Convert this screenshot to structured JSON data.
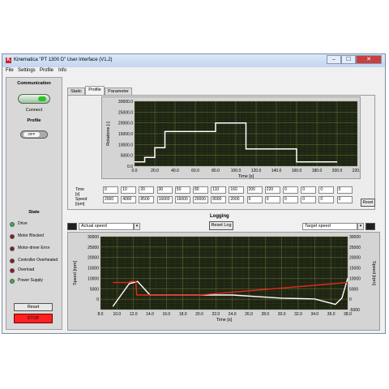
{
  "window": {
    "logo": "K",
    "title": "Kinematica \"PT 1300 D\" User Interface (V1.2)",
    "close_glyph": "✕",
    "min_glyph": "–",
    "max_glyph": "☐"
  },
  "menu": [
    "File",
    "Settings",
    "Profile",
    "Info"
  ],
  "left_panel": {
    "communication_label": "Communication",
    "connect_label": "Connect",
    "profile_label": "Profile",
    "profile_toggle": "OFF",
    "state_label": "State",
    "states": [
      {
        "label": "Drive",
        "color": "#3cb043"
      },
      {
        "label": "Motor Blocked",
        "color": "#8b1a1a"
      },
      {
        "label": "Motor-driver Error",
        "color": "#8b1a1a"
      },
      {
        "label": "Controller Overheated",
        "color": "#8b1a1a"
      },
      {
        "label": "Overload",
        "color": "#8b1a1a"
      },
      {
        "label": "Power Supply",
        "color": "#3cb043"
      }
    ],
    "reset_label": "Reset",
    "stop_label": "STOP"
  },
  "tabs": [
    {
      "label": "Static",
      "active": false
    },
    {
      "label": "Profile",
      "active": true
    },
    {
      "label": "Parameter",
      "active": false
    }
  ],
  "profile_grid": {
    "time_label": "Time [s]",
    "speed_label": "Speed [rpm]",
    "time_values": [
      "0",
      "10",
      "20",
      "30",
      "50",
      "80",
      "110",
      "160",
      "200",
      "220",
      "0",
      "0",
      "0",
      "0"
    ],
    "speed_values": [
      "2000",
      "4000",
      "8500",
      "16000",
      "16000",
      "20000",
      "8000",
      "2000",
      "0",
      "0",
      "0",
      "0",
      "0",
      "0"
    ],
    "reset_label": "Reset"
  },
  "logging": {
    "title": "Logging",
    "reset_log_label": "Reset Log",
    "left_series": "Actual speed",
    "right_series": "Target speed"
  },
  "chart_data": [
    {
      "type": "line",
      "title": "",
      "xlabel": "Time [s]",
      "ylabel": "Rotations [-]",
      "xlim": [
        0,
        220
      ],
      "ylim": [
        0,
        30000
      ],
      "x_ticks": [
        "0.0",
        "20.0",
        "40.0",
        "60.0",
        "80.0",
        "100.0",
        "120.0",
        "140.0",
        "160.0",
        "180.0",
        "200.0",
        "220.0"
      ],
      "y_ticks": [
        "0.0",
        "5000.0",
        "10000.0",
        "15000.0",
        "20000.0",
        "25000.0",
        "30000.0"
      ],
      "grid": true,
      "background": "#1e2414",
      "series": [
        {
          "color": "#ffffff",
          "x": [
            0,
            10,
            10,
            20,
            20,
            30,
            30,
            80,
            80,
            110,
            110,
            160,
            160,
            200
          ],
          "y": [
            2000,
            2000,
            4000,
            4000,
            8500,
            8500,
            16000,
            16000,
            20000,
            20000,
            8000,
            8000,
            2000,
            2000
          ]
        }
      ]
    },
    {
      "type": "line",
      "title": "",
      "xlabel": "Time [s]",
      "ylabel": "Speed [rpm]",
      "y2label": "Speed [rpm]",
      "xlim": [
        8,
        38
      ],
      "ylim": [
        -5000,
        30000
      ],
      "x_ticks": [
        "8.0",
        "10.0",
        "12.0",
        "14.0",
        "16.0",
        "18.0",
        "20.0",
        "22.0",
        "24.0",
        "26.0",
        "28.0",
        "30.0",
        "32.0",
        "34.0",
        "36.0",
        "38.0"
      ],
      "y_ticks": [
        "-5000",
        "0",
        "5000",
        "10000",
        "15000",
        "20000",
        "25000",
        "30000"
      ],
      "grid": true,
      "background": "#1e2414",
      "series": [
        {
          "name": "Actual speed",
          "color": "#ffffff",
          "x": [
            9.5,
            11.5,
            12.5,
            14,
            24,
            30,
            34,
            36.5,
            37.3,
            38
          ],
          "y": [
            -3500,
            7500,
            8500,
            2000,
            2000,
            500,
            100,
            -2500,
            500,
            10000
          ]
        },
        {
          "name": "Target speed",
          "color": "#e8281b",
          "x": [
            9.5,
            11.5,
            11.6,
            12.3,
            12.4,
            20,
            38
          ],
          "y": [
            8000,
            8000,
            8500,
            8500,
            2000,
            2000,
            8000
          ]
        }
      ]
    }
  ]
}
